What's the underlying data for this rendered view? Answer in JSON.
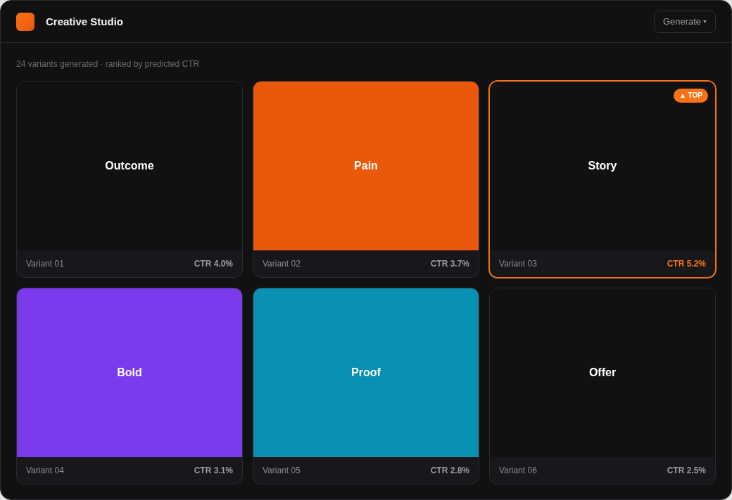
{
  "header": {
    "title": "Creative Studio",
    "generate_button": "Generate"
  },
  "summary": "24 variants generated · ranked by predicted CTR",
  "variants": [
    {
      "label": "Outcome",
      "name": "Variant 01",
      "ctr": "CTR 4.0%",
      "color": "#111112",
      "top": false
    },
    {
      "label": "Pain",
      "name": "Variant 02",
      "ctr": "CTR 3.7%",
      "color": "#ea580c",
      "top": false
    },
    {
      "label": "Story",
      "name": "Variant 03",
      "ctr": "CTR 5.2%",
      "color": "#111112",
      "top": true,
      "badge": "▲ TOP"
    },
    {
      "label": "Bold",
      "name": "Variant 04",
      "ctr": "CTR 3.1%",
      "color": "#7c3aed",
      "top": false
    },
    {
      "label": "Proof",
      "name": "Variant 05",
      "ctr": "CTR 2.8%",
      "color": "#0891b2",
      "top": false
    },
    {
      "label": "Offer",
      "name": "Variant 06",
      "ctr": "CTR 2.5%",
      "color": "#111112",
      "top": false
    }
  ]
}
